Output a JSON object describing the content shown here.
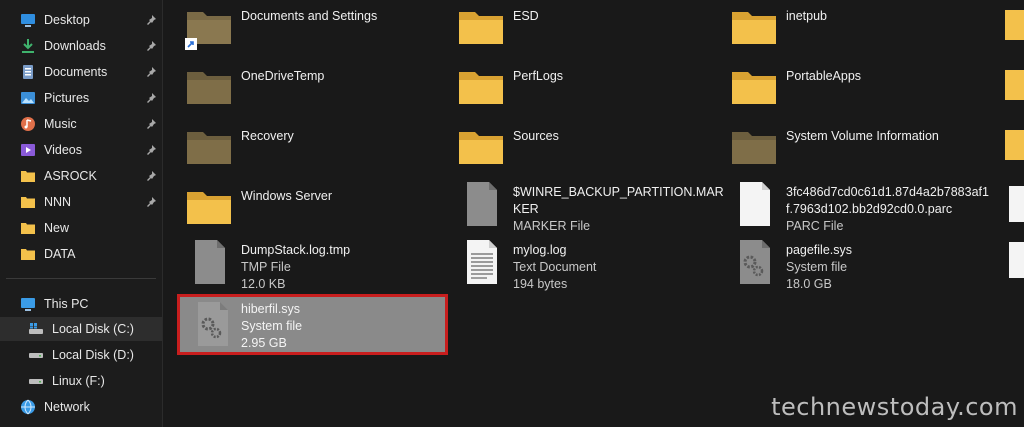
{
  "sidebar": {
    "quick_access": [
      {
        "label": "Desktop",
        "icon": "desktop-icon",
        "pinned": true
      },
      {
        "label": "Downloads",
        "icon": "download-icon",
        "pinned": true
      },
      {
        "label": "Documents",
        "icon": "documents-icon",
        "pinned": true
      },
      {
        "label": "Pictures",
        "icon": "pictures-icon",
        "pinned": true
      },
      {
        "label": "Music",
        "icon": "music-icon",
        "pinned": true
      },
      {
        "label": "Videos",
        "icon": "videos-icon",
        "pinned": true
      },
      {
        "label": "ASROCK",
        "icon": "folder-icon",
        "pinned": true
      },
      {
        "label": "NNN",
        "icon": "folder-icon",
        "pinned": true
      },
      {
        "label": "New",
        "icon": "folder-icon",
        "pinned": false
      },
      {
        "label": "DATA",
        "icon": "folder-icon",
        "pinned": false
      }
    ],
    "this_pc": "This PC",
    "drives": [
      {
        "label": "Local Disk (C:)",
        "selected": true
      },
      {
        "label": "Local Disk (D:)",
        "selected": false
      },
      {
        "label": "Linux (F:)",
        "selected": false
      }
    ],
    "network": "Network"
  },
  "items": [
    {
      "name": "Documents and Settings",
      "type": "folder-shortcut"
    },
    {
      "name": "ESD",
      "type": "folder"
    },
    {
      "name": "inetpub",
      "type": "folder"
    },
    {
      "name": "OneDriveTemp",
      "type": "folder-hidden"
    },
    {
      "name": "PerfLogs",
      "type": "folder"
    },
    {
      "name": "PortableApps",
      "type": "folder"
    },
    {
      "name": "Recovery",
      "type": "folder-hidden"
    },
    {
      "name": "Sources",
      "type": "folder"
    },
    {
      "name": "System Volume Information",
      "type": "folder-hidden"
    },
    {
      "name": "Windows Server",
      "type": "folder"
    },
    {
      "name": "$WINRE_BACKUP_PARTITION.MARKER",
      "line1": "$WINRE_BACKUP_PARTITION.MAR",
      "line2": "KER",
      "kind": "MARKER File",
      "type": "file-gray"
    },
    {
      "name": "3fc486d7cd0c61d1.87d4a2b7883af1f.7963d102.bb2d92cd0.0.parc",
      "line1": "3fc486d7cd0c61d1.87d4a2b7883af1",
      "line2": "f.7963d102.bb2d92cd0.0.parc",
      "kind": "PARC File",
      "type": "file-white"
    },
    {
      "name": "DumpStack.log.tmp",
      "kind": "TMP File",
      "size": "12.0 KB",
      "type": "file-gray"
    },
    {
      "name": "mylog.log",
      "kind": "Text Document",
      "size": "194 bytes",
      "type": "file-text"
    },
    {
      "name": "pagefile.sys",
      "kind": "System file",
      "size": "18.0 GB",
      "type": "file-system"
    },
    {
      "name": "hiberfil.sys",
      "kind": "System file",
      "size": "2.95 GB",
      "type": "file-system",
      "selected": true
    }
  ],
  "watermark": "technewstoday.com",
  "colors": {
    "folder": "#f3c14b",
    "folder_hidden": "#7a6a46",
    "highlight_border": "#c81e1e",
    "selection": "#8a8a8a"
  }
}
